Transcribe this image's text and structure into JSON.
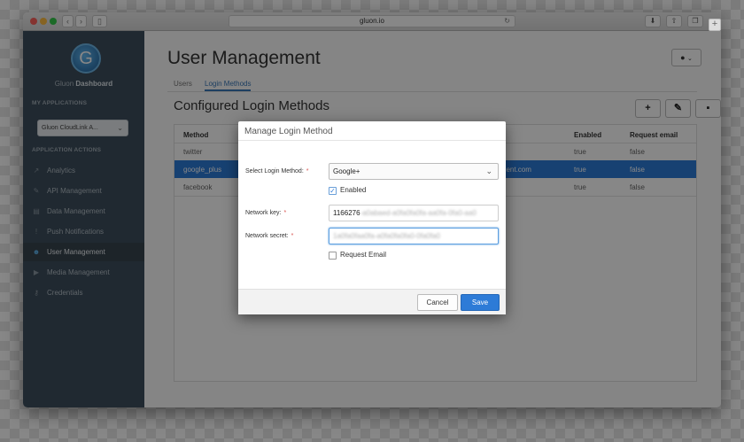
{
  "browser": {
    "url": "gluon.io"
  },
  "sidebar": {
    "logo_letter": "G",
    "brand_light": "Gluon",
    "brand_bold": "Dashboard",
    "my_applications_heading": "MY APPLICATIONS",
    "selected_app": "Gluon CloudLink A...",
    "application_actions_heading": "APPLICATION ACTIONS",
    "items": [
      {
        "label": "Analytics",
        "icon": "chart-icon"
      },
      {
        "label": "API Management",
        "icon": "wrench-icon"
      },
      {
        "label": "Data Management",
        "icon": "database-icon"
      },
      {
        "label": "Push Notifications",
        "icon": "bell-icon"
      },
      {
        "label": "User Management",
        "icon": "users-icon"
      },
      {
        "label": "Media Management",
        "icon": "media-icon"
      },
      {
        "label": "Credentials",
        "icon": "key-icon"
      }
    ],
    "active_item": "User Management"
  },
  "main": {
    "title": "User Management",
    "tabs": [
      {
        "label": "Users"
      },
      {
        "label": "Login Methods"
      }
    ],
    "active_tab": "Login Methods",
    "section_title": "Configured Login Methods",
    "table": {
      "headers": [
        "Method",
        "Enabled",
        "Request email"
      ],
      "rows": [
        {
          "method": "twitter",
          "enabled": "true",
          "request_email": "false"
        },
        {
          "method": "google_plus",
          "middle": "...lent.com",
          "enabled": "true",
          "request_email": "false"
        },
        {
          "method": "facebook",
          "enabled": "true",
          "request_email": "false"
        }
      ],
      "selected_row": 1
    }
  },
  "modal": {
    "title": "Manage Login Method",
    "select_label": "Select Login Method:",
    "select_value": "Google+",
    "enabled_label": "Enabled",
    "enabled_checked": true,
    "key_label": "Network key:",
    "key_value": "1166276",
    "key_value_obscured": "-a0abaed-a0fa0fa0fa-aa0fa-0fa0-aa0",
    "secret_label": "Network secret:",
    "secret_value_obscured": "1a0fa0faa0fa-a0fa0fa0fa0-0fa0fa0",
    "request_email_label": "Request Email",
    "request_email_checked": false,
    "cancel_label": "Cancel",
    "save_label": "Save"
  },
  "colors": {
    "accent": "#2d7bd7",
    "sidebar": "#3e4f5d",
    "required": "#d9534f"
  }
}
